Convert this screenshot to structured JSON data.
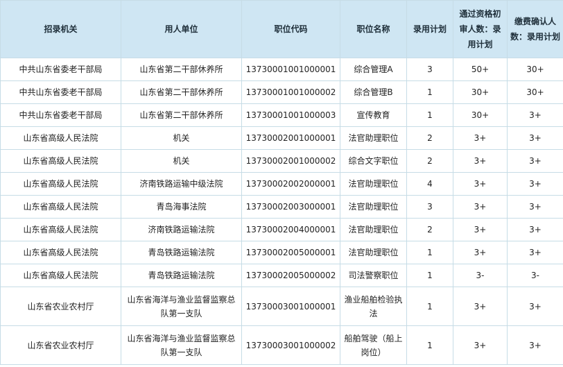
{
  "table": {
    "headers": [
      "招录机关",
      "用人单位",
      "职位代码",
      "职位名称",
      "录用计划",
      "通过资格初审人数：录用计划",
      "缴费确认人数：录用计划"
    ],
    "rows": [
      [
        "中共山东省委老干部局",
        "山东省第二干部休养所",
        "13730001001000001",
        "综合管理A",
        "3",
        "50+",
        "30+"
      ],
      [
        "中共山东省委老干部局",
        "山东省第二干部休养所",
        "13730001001000002",
        "综合管理B",
        "1",
        "30+",
        "30+"
      ],
      [
        "中共山东省委老干部局",
        "山东省第二干部休养所",
        "13730001001000003",
        "宣传教育",
        "1",
        "30+",
        "3+"
      ],
      [
        "山东省高级人民法院",
        "机关",
        "13730002001000001",
        "法官助理职位",
        "2",
        "3+",
        "3+"
      ],
      [
        "山东省高级人民法院",
        "机关",
        "13730002001000002",
        "综合文字职位",
        "2",
        "3+",
        "3+"
      ],
      [
        "山东省高级人民法院",
        "济南铁路运输中级法院",
        "13730002002000001",
        "法官助理职位",
        "4",
        "3+",
        "3+"
      ],
      [
        "山东省高级人民法院",
        "青岛海事法院",
        "13730002003000001",
        "法官助理职位",
        "3",
        "3+",
        "3+"
      ],
      [
        "山东省高级人民法院",
        "济南铁路运输法院",
        "13730002004000001",
        "法官助理职位",
        "2",
        "3+",
        "3+"
      ],
      [
        "山东省高级人民法院",
        "青岛铁路运输法院",
        "13730002005000001",
        "法官助理职位",
        "1",
        "3+",
        "3+"
      ],
      [
        "山东省高级人民法院",
        "青岛铁路运输法院",
        "13730002005000002",
        "司法警察职位",
        "1",
        "3-",
        "3-"
      ],
      [
        "山东省农业农村厅",
        "山东省海洋与渔业监督监察总队第一支队",
        "13730003001000001",
        "渔业船舶检验执法",
        "1",
        "3+",
        "3+"
      ],
      [
        "山东省农业农村厅",
        "山东省海洋与渔业监督监察总队第一支队",
        "13730003001000002",
        "船舶驾驶（船上岗位）",
        "1",
        "3+",
        "3+"
      ]
    ]
  }
}
